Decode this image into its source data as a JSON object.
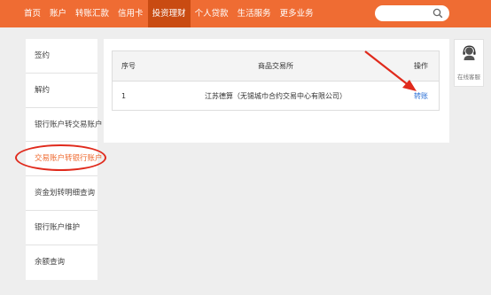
{
  "nav": {
    "items": [
      {
        "label": "首页"
      },
      {
        "label": "账户"
      },
      {
        "label": "转账汇款"
      },
      {
        "label": "信用卡"
      },
      {
        "label": "投资理财",
        "active": true
      },
      {
        "label": "个人贷款"
      },
      {
        "label": "生活服务"
      },
      {
        "label": "更多业务"
      }
    ],
    "search": {
      "value": "",
      "placeholder": "",
      "icon": "search-icon"
    }
  },
  "sidebar": {
    "items": [
      {
        "label": "签约"
      },
      {
        "label": "解约"
      },
      {
        "label": "银行账户转交易账户"
      },
      {
        "label": "交易账户转银行账户",
        "active": true
      },
      {
        "label": "资金划转明细查询"
      },
      {
        "label": "银行账户维护"
      },
      {
        "label": "余额查询"
      }
    ]
  },
  "table": {
    "headers": {
      "no": "序号",
      "exchange": "商品交易所",
      "op": "操作"
    },
    "rows": [
      {
        "no": "1",
        "exchange": "江苏德算（无锡城巾合约交易中心有限公司）",
        "op": "转账"
      }
    ]
  },
  "service": {
    "label": "在线客服",
    "icon": "customer-service-icon"
  },
  "colors": {
    "brand": "#ef6c33",
    "nav_active": "#c94b12",
    "link": "#2a6fd6",
    "annotation": "#e02a1c"
  }
}
